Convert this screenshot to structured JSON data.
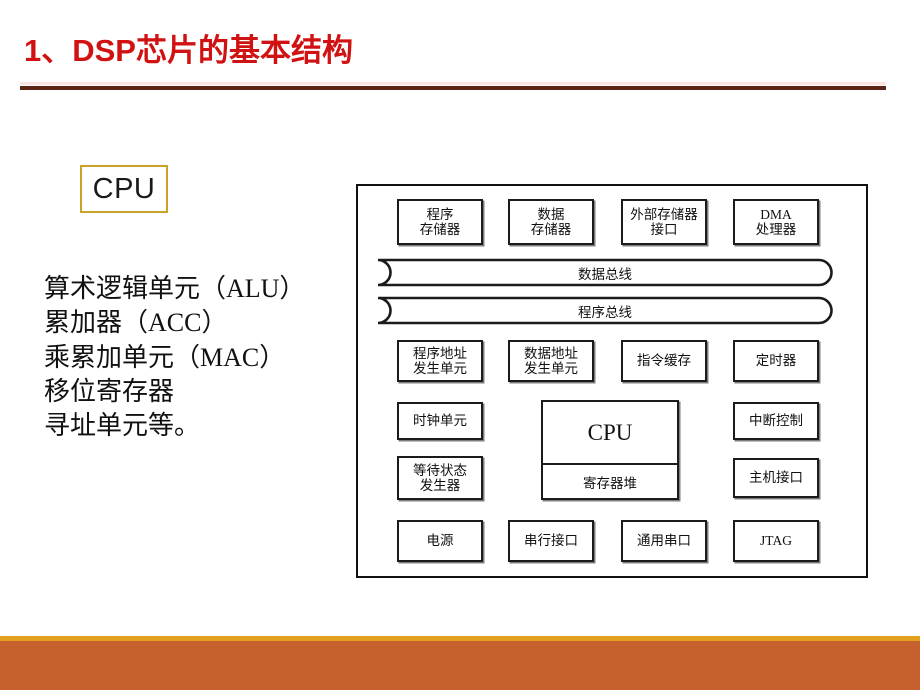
{
  "slide": {
    "title": "1、DSP芯片的基本结构",
    "accent_red": "#D11212",
    "rule_color": "#5B2415",
    "footer_gold": "#E3A01C",
    "footer_rust": "#C6602E",
    "callout_border": "#C9A227"
  },
  "callout": {
    "label": "CPU"
  },
  "description": {
    "lines": [
      "算术逻辑单元（ALU）",
      "累加器（ACC）",
      "乘累加单元（MAC）",
      "移位寄存器",
      "寻址单元等。"
    ]
  },
  "diagram": {
    "row_memory": [
      {
        "line1": "程序",
        "line2": "存储器"
      },
      {
        "line1": "数据",
        "line2": "存储器"
      },
      {
        "line1": "外部存储器",
        "line2": "接口"
      },
      {
        "line1": "DMA",
        "line2": "处理器"
      }
    ],
    "buses": [
      {
        "label": "数据总线"
      },
      {
        "label": "程序总线"
      }
    ],
    "row_address": [
      {
        "line1": "程序地址",
        "line2": "发生单元"
      },
      {
        "line1": "数据地址",
        "line2": "发生单元"
      },
      {
        "line1": "指令缓存",
        "line2": ""
      },
      {
        "line1": "定时器",
        "line2": ""
      }
    ],
    "row_clock_left": {
      "line1": "时钟单元",
      "line2": ""
    },
    "row_clock_right": {
      "line1": "中断控制",
      "line2": ""
    },
    "row_wait_left": {
      "line1": "等待状态",
      "line2": "发生器"
    },
    "row_wait_right": {
      "line1": "主机接口",
      "line2": ""
    },
    "cpu_block": {
      "title": "CPU",
      "registers": "寄存器堆"
    },
    "row_bottom": [
      {
        "line1": "电源",
        "line2": ""
      },
      {
        "line1": "串行接口",
        "line2": ""
      },
      {
        "line1": "通用串口",
        "line2": ""
      },
      {
        "line1": "JTAG",
        "line2": ""
      }
    ]
  }
}
